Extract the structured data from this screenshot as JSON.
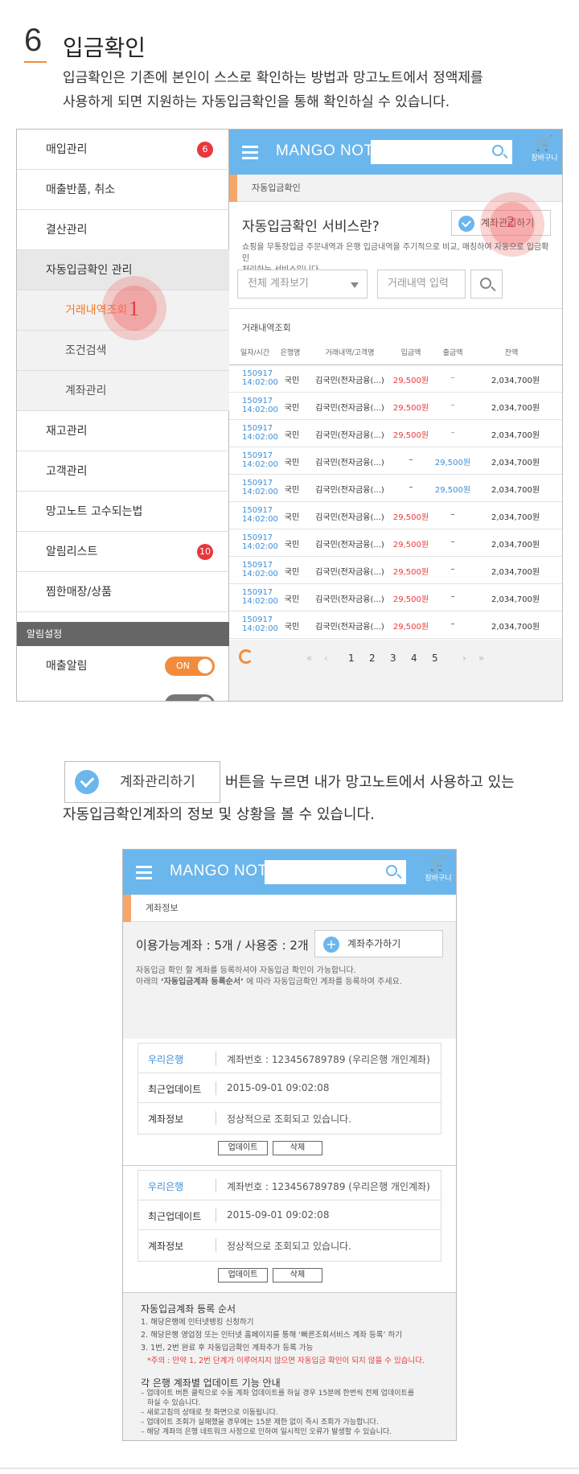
{
  "section": {
    "number": "6",
    "title": "입금확인",
    "intro_line1": "입금확인은 기존에 본인이 스스로 확인하는 방법과 망고노트에서 정액제를",
    "intro_line2": "사용하게 되면 지원하는 자동입금확인을 통해 확인하실 수 있습니다."
  },
  "sidebar": {
    "items": [
      {
        "label": "매입관리",
        "badge": "6"
      },
      {
        "label": "매출반품, 취소"
      },
      {
        "label": "결산관리"
      },
      {
        "label": "자동입금확인 관리"
      },
      {
        "label": "거래내역조회"
      },
      {
        "label": "조건검색"
      },
      {
        "label": "계좌관리"
      },
      {
        "label": "재고관리"
      },
      {
        "label": "고객관리"
      },
      {
        "label": "망고노트 고수되는법"
      },
      {
        "label": "알림리스트",
        "badge": "10"
      },
      {
        "label": "찜한매장/상품"
      }
    ],
    "alarm_header": "알림설정",
    "alarm_items": [
      {
        "label": "매출알림",
        "toggle": "ON"
      },
      {
        "label": "",
        "toggle": ""
      }
    ]
  },
  "markers": {
    "m1": "1",
    "m2": "2"
  },
  "app": {
    "logo": "MANGO NOTE",
    "cart_label": "장바구니",
    "breadcrumb": "자동입금확인"
  },
  "service": {
    "title": "자동입금확인 서비스란?",
    "button": "계좌관리하기",
    "desc_line1": "쇼핑을 무통장입금 주문내역과 은행 입금내역을 주기적으로 비교, 매칭하여 자동으로 입금확인",
    "desc_line2": "처리하는 서비스입니다.",
    "select": "전체 계좌보기",
    "search_placeholder": "거래내역 입력"
  },
  "table": {
    "label": "거래내역조회",
    "headers": [
      "일자/시간",
      "은행명",
      "거래내역/고객명",
      "입금액",
      "출금액",
      "잔액"
    ],
    "rows": [
      {
        "date": "150917",
        "time": "14:02:00",
        "bank": "국민",
        "desc": "김국민(전자금융(...)",
        "in": "29,500원",
        "out": "–",
        "bal": "2,034,700원"
      },
      {
        "date": "150917",
        "time": "14:02:00",
        "bank": "국민",
        "desc": "김국민(전자금융(...)",
        "in": "29,500원",
        "out": "–",
        "bal": "2,034,700원"
      },
      {
        "date": "150917",
        "time": "14:02:00",
        "bank": "국민",
        "desc": "김국민(전자금융(...)",
        "in": "29,500원",
        "out": "–",
        "bal": "2,034,700원"
      },
      {
        "date": "150917",
        "time": "14:02:00",
        "bank": "국민",
        "desc": "김국민(전자금융(...)",
        "in": "–",
        "out": "29,500원",
        "bal": "2,034,700원"
      },
      {
        "date": "150917",
        "time": "14:02:00",
        "bank": "국민",
        "desc": "김국민(전자금융(...)",
        "in": "–",
        "out": "29,500원",
        "bal": "2,034,700원"
      },
      {
        "date": "150917",
        "time": "14:02:00",
        "bank": "국민",
        "desc": "김국민(전자금융(...)",
        "in": "29,500원",
        "out": "–",
        "bal": "2,034,700원"
      },
      {
        "date": "150917",
        "time": "14:02:00",
        "bank": "국민",
        "desc": "김국민(전자금융(...)",
        "in": "29,500원",
        "out": "–",
        "bal": "2,034,700원"
      },
      {
        "date": "150917",
        "time": "14:02:00",
        "bank": "국민",
        "desc": "김국민(전자금융(...)",
        "in": "29,500원",
        "out": "–",
        "bal": "2,034,700원"
      },
      {
        "date": "150917",
        "time": "14:02:00",
        "bank": "국민",
        "desc": "김국민(전자금융(...)",
        "in": "29,500원",
        "out": "–",
        "bal": "2,034,700원"
      },
      {
        "date": "150917",
        "time": "14:02:00",
        "bank": "국민",
        "desc": "김국민(전자금융(...)",
        "in": "29,500원",
        "out": "–",
        "bal": "2,034,700원"
      }
    ]
  },
  "pager": {
    "first": "«",
    "prev": "‹",
    "pages": [
      "1",
      "2",
      "3",
      "4",
      "5"
    ],
    "next": "›",
    "last": "»"
  },
  "instruction": {
    "button": "계좌관리하기",
    "text1": "버튼을 누르면 내가 망고노트에서 사용하고 있는",
    "text2": "자동입금확인계좌의 정보 및 상황을 볼 수 있습니다."
  },
  "account": {
    "breadcrumb": "계좌정보",
    "summary": "이용가능계좌 : 5개 / 사용중 : 2개",
    "add_button": "계좌추가하기",
    "note1": "자동입금 확인 할 계좌를 등록하셔야 자동입금 확인이 가능합니다.",
    "note2_pre": "아래의",
    "note2_bold": "‘자동입금계좌 등록순서’",
    "note2_post": "에 따라 자동입금확인 계좌를 등록하여 주세요.",
    "cards": [
      {
        "bank": "우리은행",
        "acct": "계좌번호 : 123456789789 (우리은행 개인계좌)",
        "k_update": "최근업데이트",
        "update": "2015-09-01 09:02:08",
        "k_info": "계좌정보",
        "info": "정상적으로 조회되고 있습니다.",
        "btn_update": "업데이트",
        "btn_delete": "삭제"
      },
      {
        "bank": "우리은행",
        "acct": "계좌번호 : 123456789789 (우리은행 개인계좌)",
        "k_update": "최근업데이트",
        "update": "2015-09-01 09:02:08",
        "k_info": "계좌정보",
        "info": "정상적으로 조회되고 있습니다.",
        "btn_update": "업데이트",
        "btn_delete": "삭제"
      }
    ],
    "guide_title": "자동입금계좌 등록 순서",
    "guide": [
      "1. 해당은행에 인터넷뱅킹 신청하기",
      "2. 해당은행 영업점 또는 인터넷 홈페이지를 통해  ‘빠른조회서비스 계좌 등록’ 하기",
      "3. 1번, 2번 완료 후 자동입금확인 계좌추가 등록 가능"
    ],
    "guide_warn": "*주의 : 만약 1, 2번 단계가 이루어지지 않으면 자동입금 확인이 되지 않을 수 있습니다.",
    "update_title": "각 은행 계좌별 업데이트 기능 안내",
    "update_notes": [
      "– 업데이트 버튼 클릭으로 수동 계좌 업데이트를 하실 경우 15분에 한번씩 전체 업데이트를",
      "   하실 수 있습니다.",
      "– 새로고침의 상태로 첫 화면으로 이동됩니다.",
      "– 업데이트 조회가 실패했을 경우에는 15분 제한 없이 즉시 조회가 가능합니다.",
      "– 해당 계좌의 은행 네트워크 사정으로 인하여 일시적인 오류가 발생할 수 있습니다."
    ]
  },
  "colors": {
    "accent": "#6bb6ec",
    "orange": "#f28c3c",
    "red": "#e8383d"
  }
}
